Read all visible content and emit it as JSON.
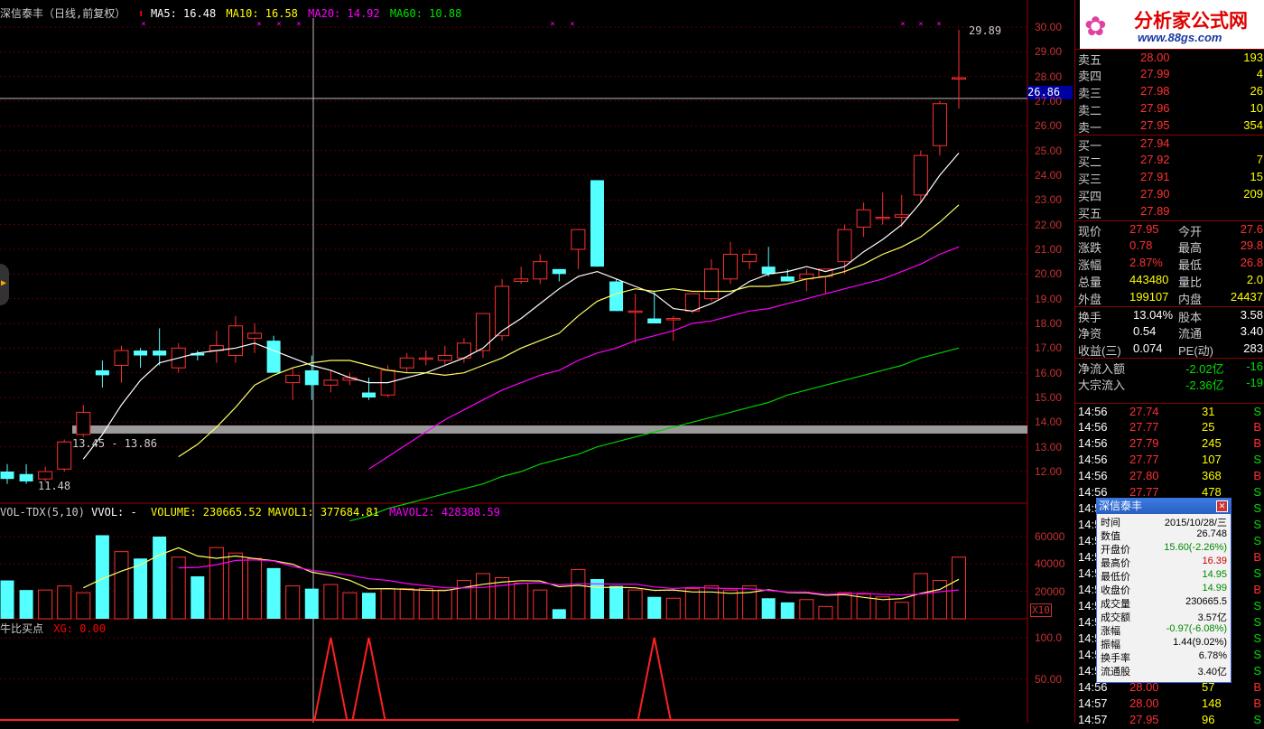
{
  "header": {
    "title": "深信泰丰（日线,前复权）",
    "ma5": "MA5: 16.48",
    "ma10": "MA10: 16.58",
    "ma20": "MA20: 14.92",
    "ma60": "MA60: 10.88"
  },
  "price_axis": [
    "30.00",
    "29.00",
    "28.00",
    "27.00",
    "26.00",
    "25.00",
    "24.00",
    "23.00",
    "22.00",
    "21.00",
    "20.00",
    "19.00",
    "18.00",
    "17.00",
    "16.00",
    "15.00",
    "14.00",
    "13.00",
    "12.00"
  ],
  "cursor_price": "26.86",
  "annotations": {
    "high_label": "29.89",
    "low_label": "11.48",
    "band_label": "13.45 - 13.86"
  },
  "vol_header": {
    "name": "VOL-TDX(5,10)",
    "vvol": "VVOL: -",
    "volume": "VOLUME: 230665.52",
    "mavol1": "MAVOL1: 377684.81",
    "mavol2": "MAVOL2: 428388.59"
  },
  "vol_axis": [
    "60000",
    "40000",
    "20000"
  ],
  "vol_unit": "X10",
  "ind_header": {
    "name": "牛比买点",
    "xg": "XG: 0.00"
  },
  "ind_axis": [
    "100.0",
    "50.00"
  ],
  "logo": {
    "text": "分析家公式网",
    "url": "www.88gs.com"
  },
  "quote": {
    "sell": [
      {
        "label": "卖五",
        "price": "28.00",
        "vol": "193"
      },
      {
        "label": "卖四",
        "price": "27.99",
        "vol": "4"
      },
      {
        "label": "卖三",
        "price": "27.98",
        "vol": "26"
      },
      {
        "label": "卖二",
        "price": "27.96",
        "vol": "10"
      },
      {
        "label": "卖一",
        "price": "27.95",
        "vol": "354"
      }
    ],
    "buy": [
      {
        "label": "买一",
        "price": "27.94",
        "vol": ""
      },
      {
        "label": "买二",
        "price": "27.92",
        "vol": "7"
      },
      {
        "label": "买三",
        "price": "27.91",
        "vol": "15"
      },
      {
        "label": "买四",
        "price": "27.90",
        "vol": "209"
      },
      {
        "label": "买五",
        "price": "27.89",
        "vol": ""
      }
    ],
    "stats": [
      {
        "k1": "现价",
        "v1": "27.95",
        "k2": "今开",
        "v2": "27.6"
      },
      {
        "k1": "涨跌",
        "v1": "0.78",
        "k2": "最高",
        "v2": "29.8"
      },
      {
        "k1": "涨幅",
        "v1": "2.87%",
        "k2": "最低",
        "v2": "26.8"
      },
      {
        "k1": "总量",
        "v1": "443480",
        "k2": "量比",
        "v2": "2.0"
      },
      {
        "k1": "外盘",
        "v1": "199107",
        "k2": "内盘",
        "v2": "24437"
      }
    ],
    "stats2": [
      {
        "k1": "换手",
        "v1": "13.04%",
        "k2": "股本",
        "v2": "3.58"
      },
      {
        "k1": "净资",
        "v1": "0.54",
        "k2": "流通",
        "v2": "3.40"
      },
      {
        "k1": "收益(三)",
        "v1": "0.074",
        "k2": "PE(动)",
        "v2": "283"
      }
    ],
    "flows": [
      {
        "k": "净流入额",
        "v": "-2.02亿",
        "v2": "-16"
      },
      {
        "k": "大宗流入",
        "v": "-2.36亿",
        "v2": "-19"
      }
    ]
  },
  "ticks": [
    {
      "t": "14:56",
      "p": "27.74",
      "v": "31",
      "s": "S"
    },
    {
      "t": "14:56",
      "p": "27.77",
      "v": "25",
      "s": "B"
    },
    {
      "t": "14:56",
      "p": "27.79",
      "v": "245",
      "s": "B"
    },
    {
      "t": "14:56",
      "p": "27.77",
      "v": "107",
      "s": "S"
    },
    {
      "t": "14:56",
      "p": "27.80",
      "v": "368",
      "s": "B"
    },
    {
      "t": "14:56",
      "p": "27.77",
      "v": "478",
      "s": "S"
    },
    {
      "t": "14:5",
      "p": "",
      "v": "",
      "s": "S"
    },
    {
      "t": "14:5",
      "p": "",
      "v": "",
      "s": "S"
    },
    {
      "t": "14:5",
      "p": "",
      "v": "",
      "s": "S"
    },
    {
      "t": "14:5",
      "p": "",
      "v": "",
      "s": "B"
    },
    {
      "t": "14:5",
      "p": "",
      "v": "",
      "s": "S"
    },
    {
      "t": "14:5",
      "p": "",
      "v": "",
      "s": "B"
    },
    {
      "t": "14:5",
      "p": "",
      "v": "",
      "s": "S"
    },
    {
      "t": "14:5",
      "p": "",
      "v": "",
      "s": "S"
    },
    {
      "t": "14:5",
      "p": "",
      "v": "",
      "s": "S"
    },
    {
      "t": "14:5",
      "p": "",
      "v": "",
      "s": "S"
    },
    {
      "t": "14:5",
      "p": "",
      "v": "",
      "s": "S"
    },
    {
      "t": "14:56",
      "p": "28.00",
      "v": "57",
      "s": "B"
    },
    {
      "t": "14:57",
      "p": "28.00",
      "v": "148",
      "s": "B"
    },
    {
      "t": "14:57",
      "p": "27.95",
      "v": "96",
      "s": "S"
    }
  ],
  "popup": {
    "title": "深信泰丰",
    "rows": [
      {
        "k": "时间",
        "v": "2015/10/28/三"
      },
      {
        "k": "数值",
        "v": "26.748"
      },
      {
        "k": "开盘价",
        "v": "15.60(-2.26%)"
      },
      {
        "k": "最高价",
        "v": "16.39"
      },
      {
        "k": "最低价",
        "v": "14.95"
      },
      {
        "k": "收盘价",
        "v": "14.99"
      },
      {
        "k": "成交量",
        "v": "230665.5"
      },
      {
        "k": "成交额",
        "v": "3.57亿"
      },
      {
        "k": "涨幅",
        "v": "-0.97(-6.08%)"
      },
      {
        "k": "振幅",
        "v": "1.44(9.02%)"
      },
      {
        "k": "换手率",
        "v": "6.78%"
      },
      {
        "k": "流通股",
        "v": "3.40亿"
      }
    ]
  },
  "chart_data": {
    "type": "candlestick",
    "candles": [
      {
        "o": 12.0,
        "h": 12.3,
        "l": 11.5,
        "c": 11.7
      },
      {
        "o": 11.9,
        "h": 12.3,
        "l": 11.5,
        "c": 11.6
      },
      {
        "o": 11.7,
        "h": 12.2,
        "l": 11.6,
        "c": 12.0
      },
      {
        "o": 12.1,
        "h": 13.3,
        "l": 12.0,
        "c": 13.2
      },
      {
        "o": 13.5,
        "h": 14.7,
        "l": 13.4,
        "c": 14.4
      },
      {
        "o": 16.1,
        "h": 16.5,
        "l": 15.4,
        "c": 15.9
      },
      {
        "o": 16.3,
        "h": 17.1,
        "l": 15.6,
        "c": 16.9
      },
      {
        "o": 16.9,
        "h": 17.0,
        "l": 16.2,
        "c": 16.7
      },
      {
        "o": 16.9,
        "h": 17.8,
        "l": 16.3,
        "c": 16.7
      },
      {
        "o": 16.2,
        "h": 17.2,
        "l": 16.0,
        "c": 17.0
      },
      {
        "o": 16.8,
        "h": 16.9,
        "l": 16.5,
        "c": 16.7
      },
      {
        "o": 16.9,
        "h": 17.7,
        "l": 16.4,
        "c": 17.1
      },
      {
        "o": 16.7,
        "h": 18.3,
        "l": 16.4,
        "c": 17.9
      },
      {
        "o": 17.4,
        "h": 18.0,
        "l": 16.8,
        "c": 17.6
      },
      {
        "o": 17.3,
        "h": 17.5,
        "l": 16.0,
        "c": 16.0
      },
      {
        "o": 15.6,
        "h": 16.2,
        "l": 14.9,
        "c": 15.9
      },
      {
        "o": 16.1,
        "h": 16.7,
        "l": 14.9,
        "c": 15.5
      },
      {
        "o": 15.5,
        "h": 16.1,
        "l": 15.2,
        "c": 15.7
      },
      {
        "o": 15.7,
        "h": 16.0,
        "l": 15.5,
        "c": 15.8
      },
      {
        "o": 15.2,
        "h": 15.8,
        "l": 14.9,
        "c": 15.0
      },
      {
        "o": 15.1,
        "h": 16.3,
        "l": 15.0,
        "c": 16.1
      },
      {
        "o": 16.2,
        "h": 16.8,
        "l": 16.0,
        "c": 16.6
      },
      {
        "o": 16.6,
        "h": 16.9,
        "l": 16.3,
        "c": 16.6
      },
      {
        "o": 16.5,
        "h": 17.1,
        "l": 16.3,
        "c": 16.7
      },
      {
        "o": 16.6,
        "h": 17.4,
        "l": 16.4,
        "c": 17.2
      },
      {
        "o": 16.9,
        "h": 18.4,
        "l": 16.6,
        "c": 18.4
      },
      {
        "o": 17.5,
        "h": 19.8,
        "l": 17.3,
        "c": 19.5
      },
      {
        "o": 19.7,
        "h": 20.3,
        "l": 19.6,
        "c": 19.8
      },
      {
        "o": 19.8,
        "h": 20.8,
        "l": 19.6,
        "c": 20.5
      },
      {
        "o": 20.2,
        "h": 20.2,
        "l": 19.7,
        "c": 20.0
      },
      {
        "o": 21.0,
        "h": 21.5,
        "l": 20.2,
        "c": 21.8
      },
      {
        "o": 23.8,
        "h": 23.8,
        "l": 20.3,
        "c": 20.3
      },
      {
        "o": 19.7,
        "h": 19.8,
        "l": 18.5,
        "c": 18.5
      },
      {
        "o": 18.5,
        "h": 19.2,
        "l": 17.2,
        "c": 18.5
      },
      {
        "o": 18.2,
        "h": 19.3,
        "l": 18.0,
        "c": 18.0
      },
      {
        "o": 18.2,
        "h": 18.3,
        "l": 17.3,
        "c": 18.2
      },
      {
        "o": 18.5,
        "h": 19.2,
        "l": 18.4,
        "c": 19.2
      },
      {
        "o": 19.0,
        "h": 20.6,
        "l": 18.9,
        "c": 20.2
      },
      {
        "o": 19.8,
        "h": 21.3,
        "l": 19.6,
        "c": 20.8
      },
      {
        "o": 20.5,
        "h": 21.0,
        "l": 20.2,
        "c": 20.8
      },
      {
        "o": 20.3,
        "h": 21.1,
        "l": 19.9,
        "c": 20.0
      },
      {
        "o": 19.9,
        "h": 20.2,
        "l": 19.7,
        "c": 19.7
      },
      {
        "o": 19.8,
        "h": 20.2,
        "l": 19.3,
        "c": 20.0
      },
      {
        "o": 19.9,
        "h": 20.2,
        "l": 19.2,
        "c": 20.2
      },
      {
        "o": 20.5,
        "h": 22.0,
        "l": 20.0,
        "c": 21.8
      },
      {
        "o": 21.9,
        "h": 22.9,
        "l": 21.5,
        "c": 22.6
      },
      {
        "o": 22.3,
        "h": 23.3,
        "l": 22.0,
        "c": 22.3
      },
      {
        "o": 22.3,
        "h": 23.2,
        "l": 21.9,
        "c": 22.4
      },
      {
        "o": 23.2,
        "h": 25.0,
        "l": 22.9,
        "c": 24.8
      },
      {
        "o": 25.2,
        "h": 27.0,
        "l": 24.8,
        "c": 26.9
      },
      {
        "o": 27.9,
        "h": 29.89,
        "l": 26.7,
        "c": 27.95
      }
    ],
    "ma5": [
      null,
      null,
      null,
      null,
      12.5,
      13.5,
      14.7,
      15.7,
      16.4,
      16.6,
      16.8,
      16.9,
      17.0,
      17.2,
      16.9,
      16.6,
      16.3,
      16.1,
      15.8,
      15.6,
      15.6,
      15.8,
      16.0,
      16.3,
      16.6,
      17.0,
      17.7,
      18.2,
      18.8,
      19.4,
      19.9,
      20.1,
      19.8,
      19.5,
      19.2,
      18.6,
      18.5,
      18.8,
      19.2,
      19.7,
      20.0,
      20.1,
      20.3,
      20.1,
      20.3,
      20.9,
      21.4,
      22.0,
      22.9,
      24.0,
      24.9
    ],
    "ma10": [
      null,
      null,
      null,
      null,
      null,
      null,
      null,
      null,
      null,
      12.6,
      13.1,
      13.8,
      14.6,
      15.5,
      15.9,
      16.2,
      16.4,
      16.5,
      16.5,
      16.3,
      16.1,
      16.0,
      16.0,
      15.9,
      16.0,
      16.3,
      16.6,
      17.0,
      17.3,
      17.6,
      18.3,
      18.9,
      19.2,
      19.4,
      19.3,
      19.4,
      19.3,
      19.3,
      19.3,
      19.5,
      19.5,
      19.6,
      19.8,
      19.9,
      20.1,
      20.4,
      20.8,
      21.1,
      21.5,
      22.1,
      22.8
    ],
    "ma20": [
      null,
      null,
      null,
      null,
      null,
      null,
      null,
      null,
      null,
      null,
      null,
      null,
      null,
      null,
      null,
      null,
      null,
      null,
      null,
      12.1,
      12.6,
      13.1,
      13.6,
      14.1,
      14.5,
      14.9,
      15.3,
      15.6,
      15.9,
      16.1,
      16.5,
      16.8,
      17.0,
      17.3,
      17.5,
      17.7,
      18.0,
      18.1,
      18.3,
      18.5,
      18.6,
      18.8,
      19.0,
      19.2,
      19.4,
      19.6,
      19.8,
      20.1,
      20.4,
      20.8,
      21.1
    ],
    "ma60": [
      null,
      null,
      null,
      null,
      null,
      null,
      null,
      null,
      null,
      null,
      null,
      null,
      null,
      null,
      null,
      null,
      null,
      null,
      10.0,
      10.2,
      10.5,
      10.7,
      10.9,
      11.1,
      11.3,
      11.5,
      11.8,
      12.0,
      12.3,
      12.5,
      12.7,
      13.0,
      13.2,
      13.4,
      13.6,
      13.8,
      14.0,
      14.2,
      14.4,
      14.6,
      14.8,
      15.1,
      15.3,
      15.5,
      15.7,
      15.9,
      16.1,
      16.3,
      16.6,
      16.8,
      17.0
    ],
    "volume": [
      28000,
      21000,
      21000,
      24000,
      19000,
      61000,
      49000,
      44000,
      60000,
      45000,
      31000,
      52000,
      48000,
      44000,
      37000,
      24000,
      22000,
      25000,
      19000,
      19000,
      22000,
      22000,
      22000,
      21000,
      28000,
      33000,
      30000,
      26000,
      21000,
      7000,
      36000,
      29000,
      24000,
      21000,
      16000,
      15000,
      22000,
      24000,
      21000,
      24000,
      15000,
      12000,
      14000,
      9000,
      19000,
      18000,
      16000,
      12000,
      33000,
      28000,
      45000
    ],
    "vol_ma1": [
      null,
      null,
      null,
      null,
      22600,
      29200,
      34800,
      39400,
      46600,
      51800,
      45800,
      44200,
      45800,
      44000,
      42400,
      39800,
      34000,
      31600,
      28000,
      21800,
      22000,
      21400,
      20800,
      20600,
      22800,
      25200,
      26800,
      27800,
      27600,
      23400,
      24400,
      22800,
      23000,
      22600,
      20800,
      21000,
      19600,
      19600,
      18600,
      19200,
      21200,
      19200,
      19000,
      17200,
      17600,
      15600,
      14000,
      14800,
      18600,
      21400,
      28800
    ],
    "vol_ma2": [
      null,
      null,
      null,
      null,
      null,
      null,
      null,
      null,
      null,
      37200,
      37500,
      39500,
      42600,
      43000,
      42200,
      38100,
      35400,
      33600,
      31800,
      29200,
      28000,
      25700,
      24100,
      22700,
      22500,
      22900,
      24300,
      25800,
      26300,
      24800,
      25500,
      25500,
      25300,
      25300,
      23300,
      22100,
      22900,
      22400,
      22100,
      21900,
      20700,
      19500,
      19500,
      17800,
      18400,
      18600,
      17800,
      17400,
      18100,
      19800,
      21000
    ],
    "signal_spikes": [
      17,
      19,
      34
    ],
    "xlabel": "",
    "ylabel": ""
  }
}
